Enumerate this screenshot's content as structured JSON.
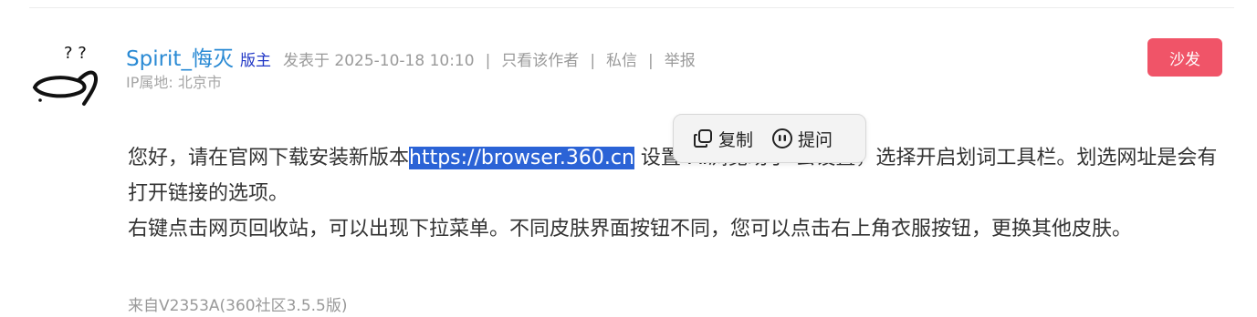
{
  "post": {
    "username": "Spirit_悔灭",
    "role_badge": "版主",
    "posted_at": "发表于 2025-10-18 10:10",
    "actions": {
      "only_author": "只看该作者",
      "private_message": "私信",
      "report": "举报"
    },
    "separator": "|",
    "ip_location": "IP属地: 北京市",
    "reply_button": "沙发",
    "content": {
      "line1_before": "您好，请在官网下载安装新版本",
      "url": "https://browser.360.cn",
      "line1_after": " 设置-AI浏览助手-去设置，选择开启划词工具栏。划选网址是会有打开链接的选项。",
      "paragraph2": "右键点击网页回收站，可以出现下拉菜单。不同皮肤界面按钮不同，您可以点击右上角衣服按钮，更换其他皮肤。"
    },
    "source": "来自V2353A(360社区3.5.5版)"
  },
  "selection_toolbar": {
    "copy_label": "复制",
    "ask_label": "提问"
  },
  "colors": {
    "username": "#2a8ad4",
    "badge": "#2137c6",
    "reply_button": "#f05468",
    "selection": "#2b63d6"
  }
}
